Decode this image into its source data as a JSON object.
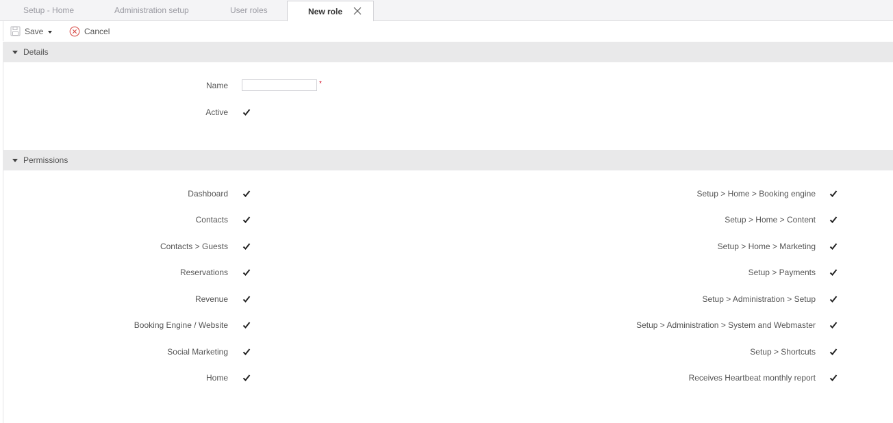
{
  "tabs": [
    {
      "label": "Setup - Home"
    },
    {
      "label": "Administration setup"
    },
    {
      "label": "User roles"
    },
    {
      "label": "New role",
      "active": true
    }
  ],
  "toolbar": {
    "save_label": "Save",
    "cancel_label": "Cancel"
  },
  "details": {
    "title": "Details",
    "name_label": "Name",
    "name_value": "",
    "required_marker": "*",
    "active_label": "Active",
    "active_checked": true
  },
  "permissions": {
    "title": "Permissions",
    "left": [
      {
        "label": "Dashboard",
        "checked": true
      },
      {
        "label": "Contacts",
        "checked": true
      },
      {
        "label": "Contacts > Guests",
        "checked": true
      },
      {
        "label": "Reservations",
        "checked": true
      },
      {
        "label": "Revenue",
        "checked": true
      },
      {
        "label": "Booking Engine / Website",
        "checked": true
      },
      {
        "label": "Social Marketing",
        "checked": true
      },
      {
        "label": "Home",
        "checked": true
      }
    ],
    "right": [
      {
        "label": "Setup > Home > Booking engine",
        "checked": true
      },
      {
        "label": "Setup > Home > Content",
        "checked": true
      },
      {
        "label": "Setup > Home > Marketing",
        "checked": true
      },
      {
        "label": "Setup > Payments",
        "checked": true
      },
      {
        "label": "Setup > Administration > Setup",
        "checked": true
      },
      {
        "label": "Setup > Administration > System and Webmaster",
        "checked": true
      },
      {
        "label": "Setup > Shortcuts",
        "checked": true
      },
      {
        "label": "Receives Heartbeat monthly report",
        "checked": true
      }
    ]
  },
  "colors": {
    "required": "#d0021b",
    "cancel_icon": "#d9534f",
    "header_bg": "#e9e9ea"
  }
}
